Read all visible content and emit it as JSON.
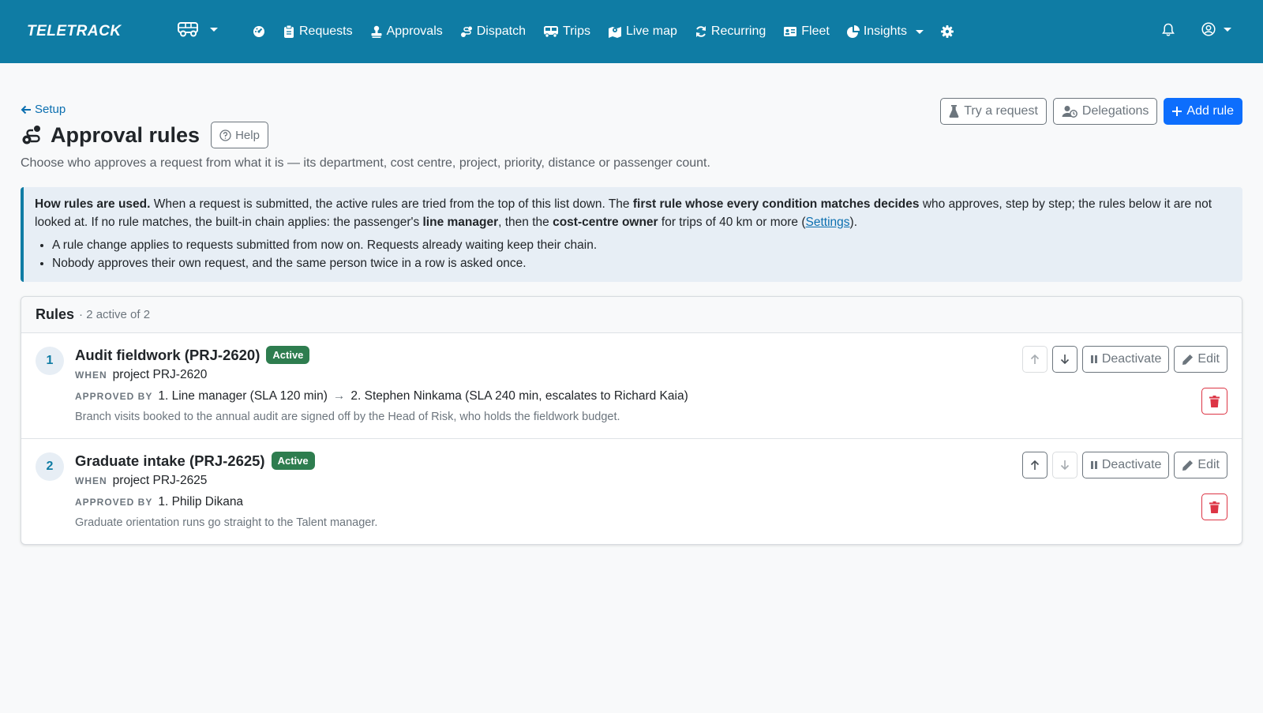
{
  "navbar": {
    "brand": "TELETRACK",
    "links": [
      {
        "label": "Requests",
        "icon": "clipboard-icon"
      },
      {
        "label": "Approvals",
        "icon": "stamp-icon"
      },
      {
        "label": "Dispatch",
        "icon": "route-icon"
      },
      {
        "label": "Trips",
        "icon": "bus-icon"
      },
      {
        "label": "Live map",
        "icon": "map-location-icon"
      },
      {
        "label": "Recurring",
        "icon": "repeat-icon"
      },
      {
        "label": "Fleet",
        "icon": "id-card-icon"
      },
      {
        "label": "Insights",
        "icon": "pie-chart-icon"
      }
    ]
  },
  "page": {
    "back_label": "Setup",
    "title": "Approval rules",
    "help_label": "Help",
    "subtitle": "Choose who approves a request from what it is — its department, cost centre, project, priority, distance or passenger count.",
    "actions": {
      "try_label": "Try a request",
      "delegations_label": "Delegations",
      "add_label": "Add rule"
    }
  },
  "info": {
    "lead": "How rules are used.",
    "p1": " When a request is submitted, the active rules are tried from the top of this list down. The ",
    "b1": "first rule whose every condition matches decides",
    "p2": " who approves, step by step; the rules below it are not looked at. If no rule matches, the built-in chain applies: the passenger's ",
    "b2": "line manager",
    "p3": ", then the ",
    "b3": "cost-centre owner",
    "p4": " for trips of 40 km or more (",
    "link": "Settings",
    "p5": ").",
    "bullets": [
      "A rule change applies to requests submitted from now on. Requests already waiting keep their chain.",
      "Nobody approves their own request, and the same person twice in a row is asked once."
    ]
  },
  "rules_card": {
    "title": "Rules",
    "count": "· 2 active of 2",
    "when_kw": "WHEN",
    "approved_kw": "APPROVED BY",
    "deactivate_label": "Deactivate",
    "edit_label": "Edit",
    "rules": [
      {
        "num": "1",
        "title": "Audit fieldwork (PRJ-2620)",
        "status": "Active",
        "when": "project PRJ-2620",
        "step1": "1. Line manager (SLA 120 min)",
        "arrow": "→",
        "step2": "2. Stephen Ninkama (SLA 240 min, escalates to Richard Kaia)",
        "note": "Branch visits booked to the annual audit are signed off by the Head of Risk, who holds the fieldwork budget."
      },
      {
        "num": "2",
        "title": "Graduate intake (PRJ-2625)",
        "status": "Active",
        "when": "project PRJ-2625",
        "step1": "1. Philip Dikana",
        "note": "Graduate orientation runs go straight to the Talent manager."
      }
    ]
  },
  "colors": {
    "navbar": "#0f7ca4",
    "primary": "#0d6efd",
    "active_badge": "#2e7d4f",
    "danger": "#dc3545"
  }
}
